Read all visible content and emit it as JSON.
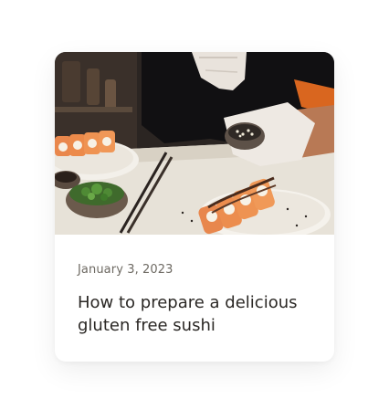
{
  "post": {
    "date": "January 3, 2023",
    "title": "How to prepare a delicious gluten free sushi"
  }
}
